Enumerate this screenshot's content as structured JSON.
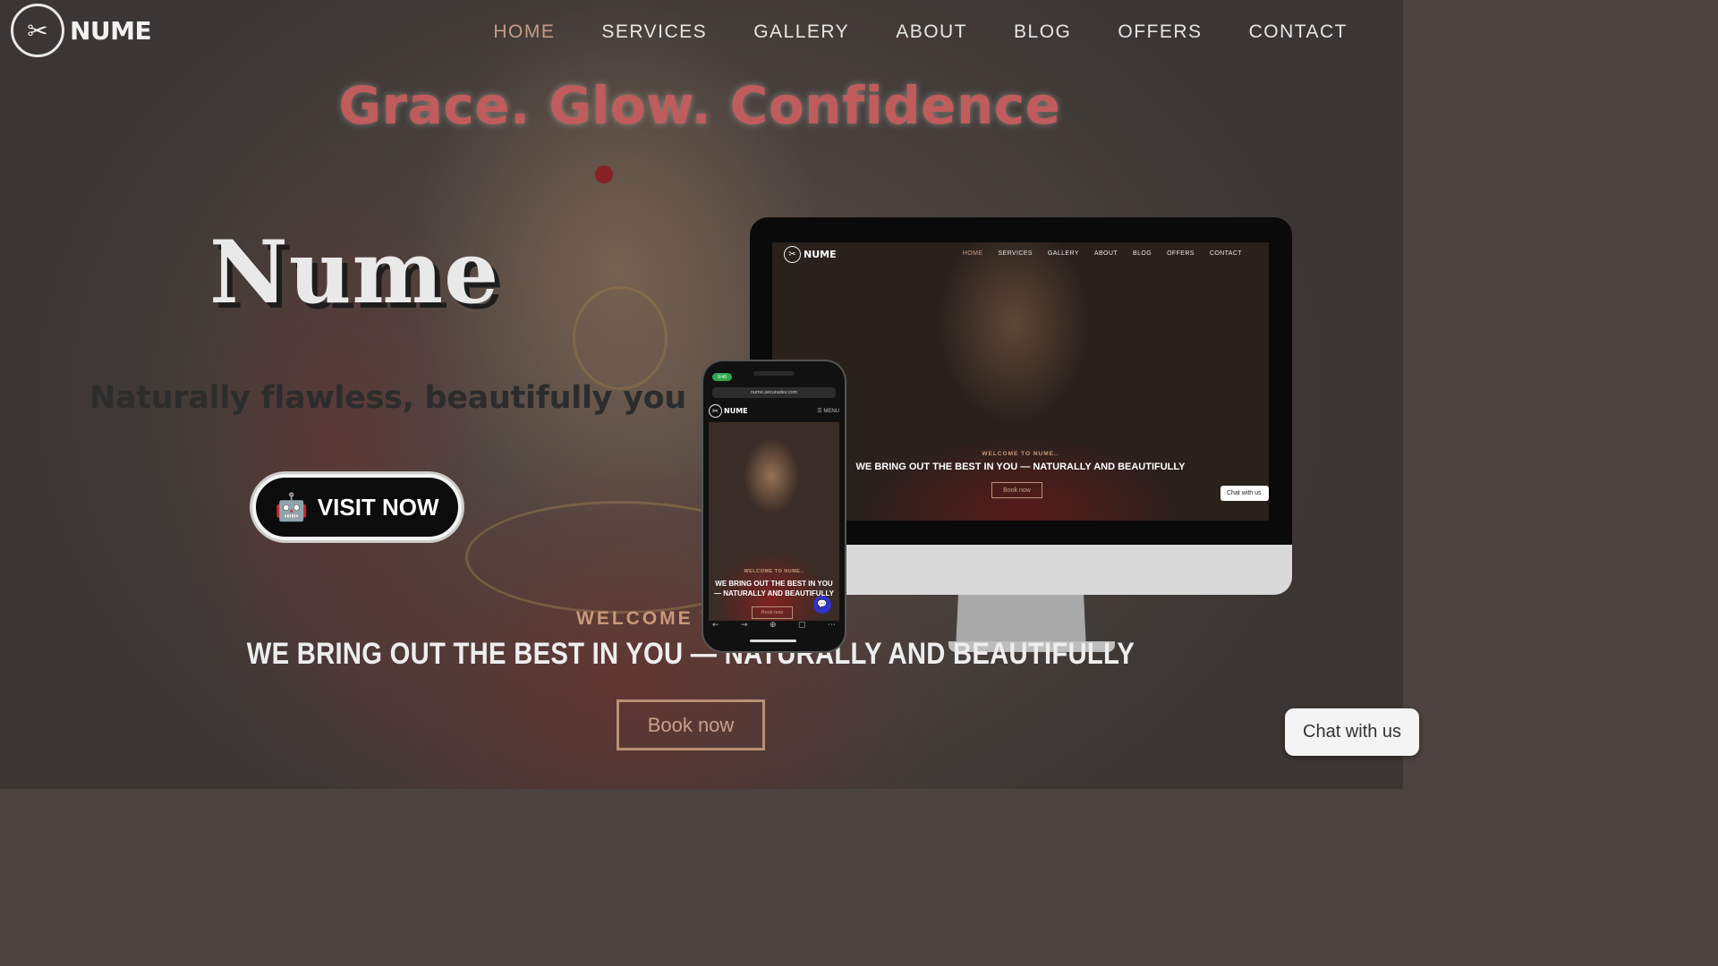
{
  "header": {
    "logo_text": "NUME",
    "logo_icon": "scissors-icon",
    "nav": [
      {
        "label": "HOME",
        "active": true
      },
      {
        "label": "SERVICES"
      },
      {
        "label": "GALLERY"
      },
      {
        "label": "ABOUT"
      },
      {
        "label": "BLOG"
      },
      {
        "label": "OFFERS"
      },
      {
        "label": "CONTACT"
      }
    ]
  },
  "hero": {
    "tagline": "Grace. Glow. Confidence",
    "brand": "Nume",
    "subtitle": "Naturally flawless, beautifully you",
    "visit_button": "VISIT NOW",
    "visit_icon": "robot-icon",
    "welcome": "WELCOME T",
    "headline": "WE BRING OUT THE BEST IN YOU — NATURALLY AND BEAUTIFULLY",
    "book_button": "Book now"
  },
  "chat_widget": {
    "label": "Chat with us"
  },
  "desktop_mockup": {
    "logo_text": "NUME",
    "nav": [
      "HOME",
      "SERVICES",
      "GALLERY",
      "ABOUT",
      "BLOG",
      "OFFERS",
      "CONTACT"
    ],
    "welcome": "WELCOME TO NUME..",
    "headline": "WE BRING OUT THE BEST IN YOU — NATURALLY AND BEAUTIFULLY",
    "book_button": "Book now",
    "chat": "Chat with us"
  },
  "phone_mockup": {
    "time": "9:40",
    "url": "nume.securadev.com",
    "logo_text": "NUME",
    "menu": "☰ MENU",
    "welcome": "WELCOME TO NUME..",
    "headline": "WE BRING OUT THE BEST IN YOU — NATURALLY AND BEAUTIFULLY",
    "book_button": "Book now"
  },
  "colors": {
    "accent_nav_active": "#c79b86",
    "tagline": "#c15c5c",
    "gold": "#c89a78",
    "chat_bubble": "#3132c9"
  }
}
